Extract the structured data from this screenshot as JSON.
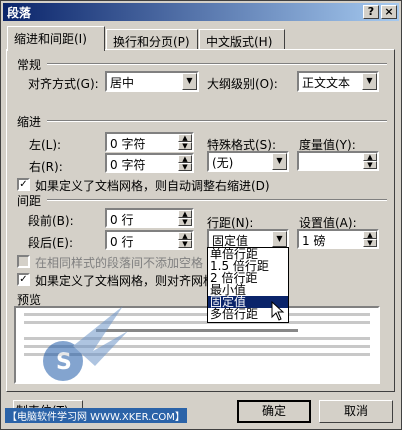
{
  "dialog": {
    "title": "段落",
    "help_button": "?",
    "close_button": "×"
  },
  "tabs": [
    {
      "label": "缩进和间距(I)"
    },
    {
      "label": "换行和分页(P)"
    },
    {
      "label": "中文版式(H)"
    }
  ],
  "general": {
    "section": "常规",
    "alignment_label": "对齐方式(G):",
    "alignment_value": "居中",
    "outline_label": "大纲级别(O):",
    "outline_value": "正文文本"
  },
  "indent": {
    "section": "缩进",
    "left_label": "左(L):",
    "left_value": "0 字符",
    "right_label": "右(R):",
    "right_value": "0 字符",
    "special_label": "特殊格式(S):",
    "special_value": "(无)",
    "by_label": "度量值(Y):",
    "by_value": "",
    "grid_check_label": "如果定义了文档网格，则自动调整右缩进(D)"
  },
  "spacing": {
    "section": "间距",
    "before_label": "段前(B):",
    "before_value": "0 行",
    "after_label": "段后(E):",
    "after_value": "0 行",
    "line_label": "行距(N):",
    "line_value": "固定值",
    "at_label": "设置值(A):",
    "at_value": "1 磅",
    "nospace_label": "在相同样式的段落间不添加空格",
    "snap_label": "如果定义了文档网格，则对齐网格",
    "line_options": [
      "单倍行距",
      "1.5 倍行距",
      "2 倍行距",
      "最小值",
      "固定值",
      "多倍行距"
    ]
  },
  "preview": {
    "section": "预览"
  },
  "buttons": {
    "tabs": "制表位(T)...",
    "ok": "确定",
    "cancel": "取消"
  },
  "watermark": "【电脑软件学习网 WWW.XKER.COM】"
}
